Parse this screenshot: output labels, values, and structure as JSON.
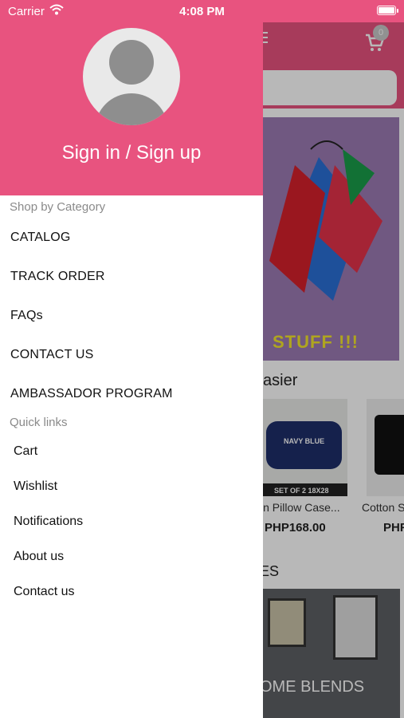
{
  "status_bar": {
    "carrier": "Carrier",
    "time": "4:08 PM"
  },
  "drawer": {
    "sign_in_label": "Sign in / Sign up",
    "shop_by_category_label": "Shop by Category",
    "categories": [
      "CATALOG",
      "TRACK ORDER",
      "FAQs",
      "CONTACT US",
      "AMBASSADOR PROGRAM"
    ],
    "quick_links_label": "Quick links",
    "quick_links": [
      "Cart",
      "Wishlist",
      "Notifications",
      "About us",
      "Contact us"
    ]
  },
  "background": {
    "cart_count": "0",
    "banner_text": "STUFF !!!",
    "section_title": "e Easier",
    "products": [
      {
        "image_text_1": "NAVY BLUE",
        "image_text_2": "SET OF 2 18X28",
        "name": "in Pillow Case...",
        "price": "PHP168.00"
      },
      {
        "name": "Cotton S",
        "price": "PHF"
      }
    ],
    "section2_title": "NCES",
    "room_text": "OME BLENDS"
  },
  "colors": {
    "brand": "#E8537F",
    "banner": "#9c7bb3"
  }
}
